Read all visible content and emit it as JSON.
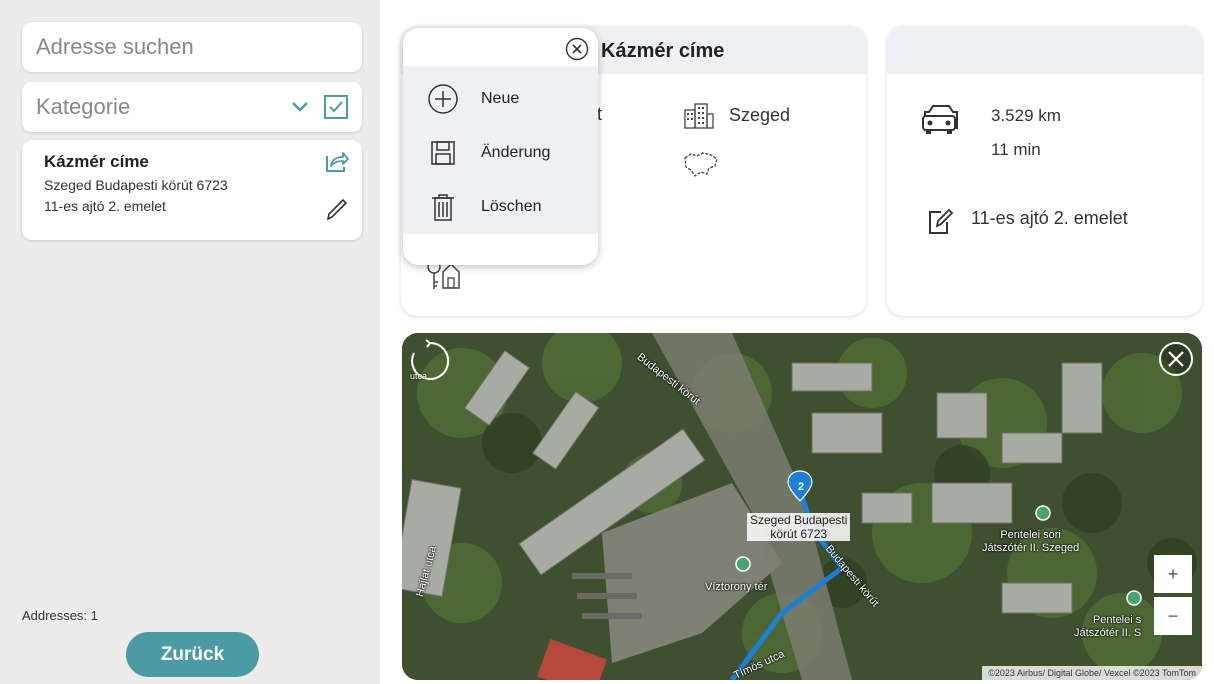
{
  "search": {
    "placeholder": "Adresse suchen"
  },
  "category": {
    "label": "Kategorie",
    "checked": true
  },
  "address_card": {
    "title": "Kázmér címe",
    "line1": "Szeged Budapesti körút  6723",
    "line2": "11-es ajtó 2. emelet"
  },
  "footer": {
    "count_text": "Addresses: 1",
    "back_label": "Zurück"
  },
  "details": {
    "title": "Kázmér címe",
    "partial_text": "t",
    "city": "Szeged"
  },
  "route": {
    "distance": "3.529 km",
    "time": "11 min",
    "note": "11-es ajtó 2. emelet"
  },
  "popup": {
    "items": [
      {
        "label": "Neue",
        "icon": "plus-circle-icon"
      },
      {
        "label": "Änderung",
        "icon": "save-icon"
      },
      {
        "label": "Löschen",
        "icon": "trash-icon"
      }
    ]
  },
  "map": {
    "street_top": "Budapesti körút",
    "street_bottom": "Budapesti körút",
    "street_left": "Hajlat utca",
    "street_bottom_left": "Tímös utca",
    "pin_number": "2",
    "pin_label_line1": "Szeged Budapesti",
    "pin_label_line2": "körút 6723",
    "poi1": "Víztorony tér",
    "poi2_line1": "Pentelei sori",
    "poi2_line2": "Játszótér II. Szeged",
    "poi3_line1": "Pentelei s",
    "poi3_line2": "Játszótér II. S",
    "compass_label": "utca",
    "zoom_in": "+",
    "zoom_out": "−",
    "copyright": "©2023 Airbus/ Digital Globe/ Vexcel ©2023 TomTom"
  },
  "colors": {
    "accent": "#4a9ba3",
    "route": "#1e7fd6",
    "card_header": "#eef0f3"
  }
}
